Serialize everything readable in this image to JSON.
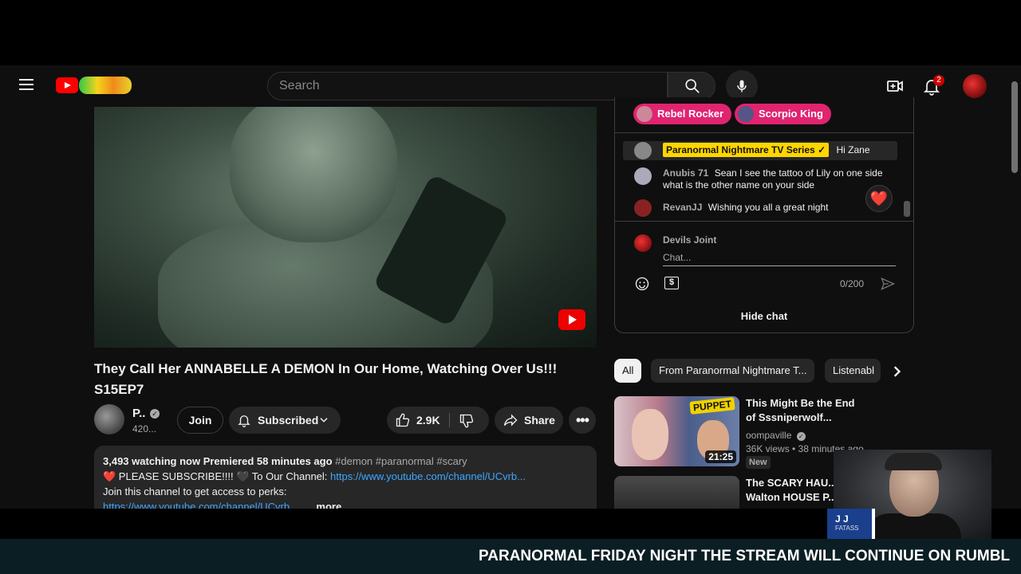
{
  "header": {
    "search_placeholder": "Search",
    "notification_count": "2"
  },
  "video": {
    "title": "They Call Her ANNABELLE A DEMON In Our Home, Watching Over Us!!! S15EP7",
    "channel_name": "P..",
    "subscribers": "420...",
    "join_label": "Join",
    "subscribed_label": "Subscribed",
    "likes": "2.9K",
    "share_label": "Share"
  },
  "description": {
    "stats": "3,493 watching now  Premiered 58 minutes ago",
    "tags": "#demon #paranormal #scary",
    "line2_prefix": "❤️ PLEASE SUBSCRIBE!!!! 🖤 To Our Channel: ",
    "line2_link": "https://www.youtube.com/channel/UCvrb...",
    "line3": "Join this channel to get access to perks:",
    "line4_link": "https://www.youtube.com/channel/UCvrb...",
    "more_label": "...more"
  },
  "chat": {
    "ticker": [
      {
        "name": "Rebel Rocker"
      },
      {
        "name": "Scorpio King"
      }
    ],
    "messages": [
      {
        "author": "Paranormal Nightmare TV Series ✓",
        "text": "Hi Zane"
      },
      {
        "author": "Anubis 71",
        "text": "Sean I see the tattoo of Lily on one side what is the other name on your side"
      },
      {
        "author": "RevanJJ",
        "text": "Wishing you all a great night"
      }
    ],
    "input_user": "Devils Joint",
    "input_placeholder": "Chat...",
    "char_count": "0/200",
    "hide_label": "Hide chat",
    "heart": "❤️"
  },
  "filters": [
    {
      "label": "All",
      "active": true
    },
    {
      "label": "From Paranormal Nightmare T..."
    },
    {
      "label": "Listenabl"
    }
  ],
  "recommendations": [
    {
      "title": "This Might Be the End of Sssniperwolf...",
      "channel": "oompaville",
      "meta": "36K views • 38 minutes ago",
      "badge": "New",
      "duration": "21:25",
      "thumb_tag": "PUPPET"
    },
    {
      "title": "The SCARY HAU... Walton HOUSE P..."
    }
  ],
  "overlay": {
    "cam_name": "J J",
    "cam_sub": "FATASS",
    "ticker_text": "PARANORMAL FRIDAY NIGHT  THE STREAM WILL CONTINUE ON RUMBL"
  },
  "colors": {
    "accent": "#ff0000",
    "chip_pink": "#e0246f",
    "link": "#3ea6ff",
    "member_badge": "#ffd600"
  }
}
